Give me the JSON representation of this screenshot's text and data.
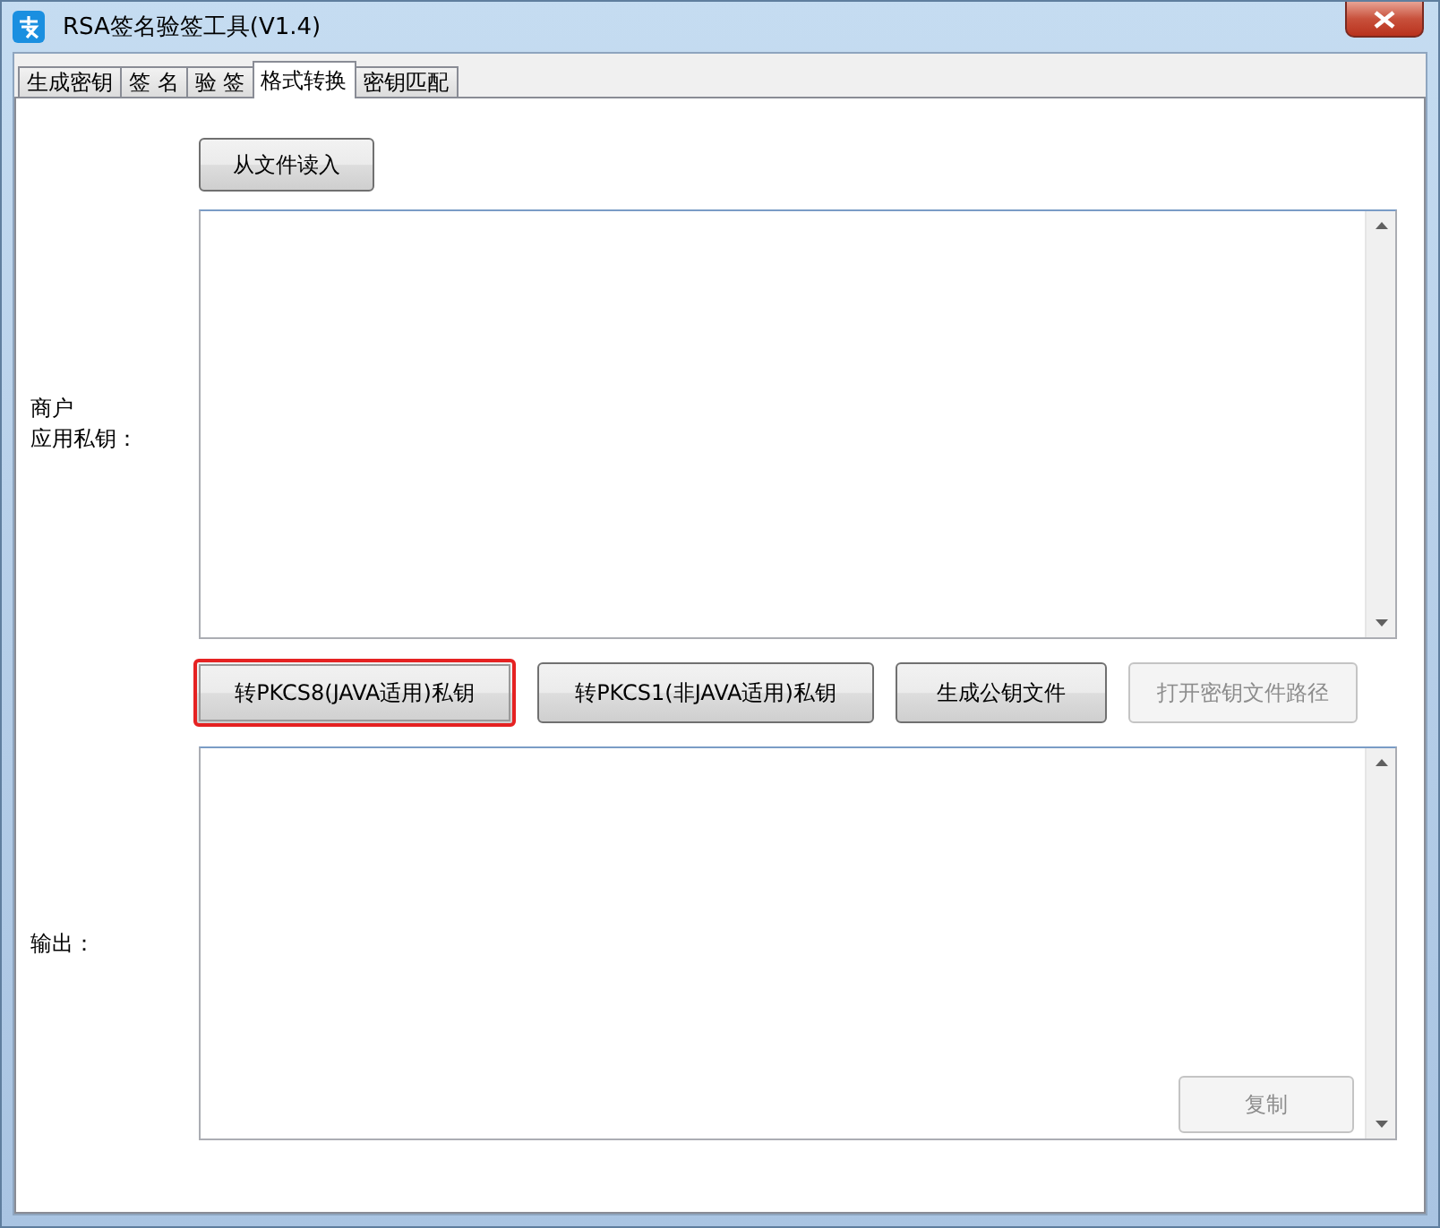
{
  "window": {
    "title": "RSA签名验签工具(V1.4)"
  },
  "tabs": [
    {
      "label": "生成密钥",
      "selected": false
    },
    {
      "label": "签 名",
      "selected": false
    },
    {
      "label": "验 签",
      "selected": false
    },
    {
      "label": "格式转换",
      "selected": true
    },
    {
      "label": "密钥匹配",
      "selected": false
    }
  ],
  "load_button": {
    "label": "从文件读入"
  },
  "input": {
    "label_lines": [
      "商户",
      "应用私钥："
    ]
  },
  "actions": [
    {
      "label": "转PKCS8(JAVA适用)私钥",
      "highlighted": true,
      "disabled": false
    },
    {
      "label": "转PKCS1(非JAVA适用)私钥",
      "highlighted": false,
      "disabled": false
    },
    {
      "label": "生成公钥文件",
      "highlighted": false,
      "disabled": false
    },
    {
      "label": "打开密钥文件路径",
      "highlighted": false,
      "disabled": true
    }
  ],
  "output": {
    "label": "输出：",
    "copy_button": {
      "label": "复制",
      "disabled": true
    }
  }
}
